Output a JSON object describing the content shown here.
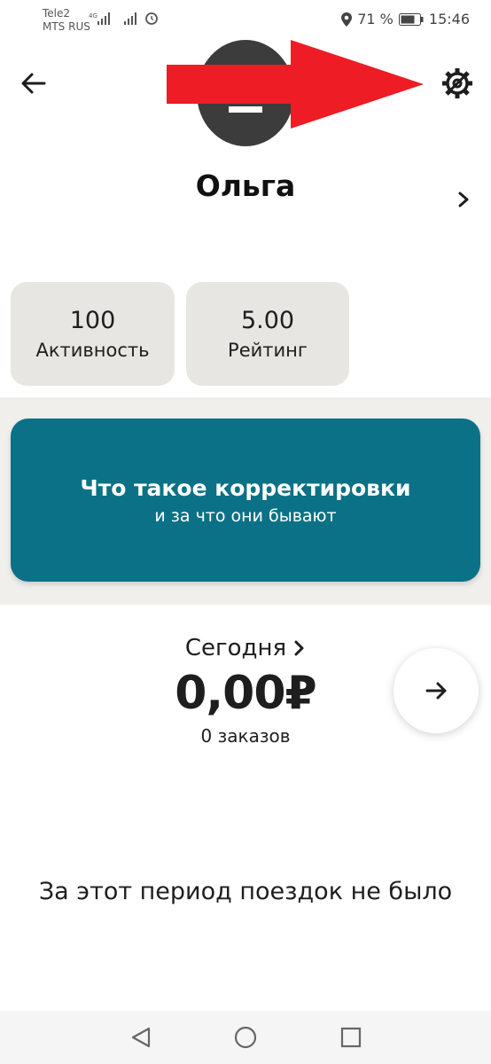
{
  "status_bar": {
    "carrier1": "Tele2",
    "carrier2": "MTS RUS",
    "network": "4G",
    "battery": "71 %",
    "time": "15:46"
  },
  "header": {
    "back_icon": "arrow-left-icon",
    "settings_icon": "gear-icon",
    "profile_name": "Ольга"
  },
  "stats": [
    {
      "value": "100",
      "label": "Активность"
    },
    {
      "value": "5.00",
      "label": "Рейтинг"
    }
  ],
  "banner": {
    "title": "Что такое корректировки",
    "subtitle": "и за что они бывают",
    "color": "#0b7187"
  },
  "earnings": {
    "period": "Сегодня",
    "amount": "0,00₽",
    "orders": "0 заказов"
  },
  "empty_message": "За этот период поездок не было",
  "annotation": {
    "color": "#ee1c25"
  }
}
